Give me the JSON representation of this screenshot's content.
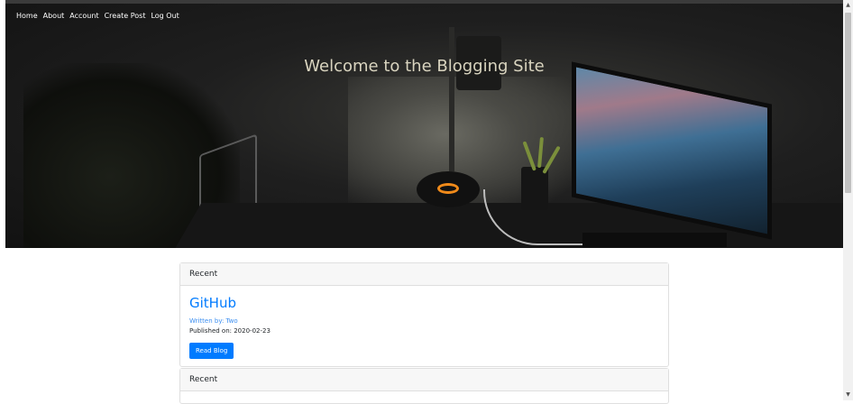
{
  "nav": {
    "items": [
      {
        "label": "Home"
      },
      {
        "label": "About"
      },
      {
        "label": "Account"
      },
      {
        "label": "Create Post"
      },
      {
        "label": "Log Out"
      }
    ]
  },
  "hero": {
    "title": "Welcome to the Blogging Site"
  },
  "posts": [
    {
      "header": "Recent",
      "title": "GitHub",
      "author": "Written by: Two",
      "published": "Published on: 2020-02-23",
      "button_label": "Read Blog"
    },
    {
      "header": "Recent"
    }
  ],
  "colors": {
    "accent": "#007bff",
    "hero_title": "#d9d4bf",
    "lamp_logo": "#f08a1a"
  },
  "icons": {
    "scroll_up": "chevron-up-icon",
    "scroll_down": "chevron-down-icon"
  }
}
